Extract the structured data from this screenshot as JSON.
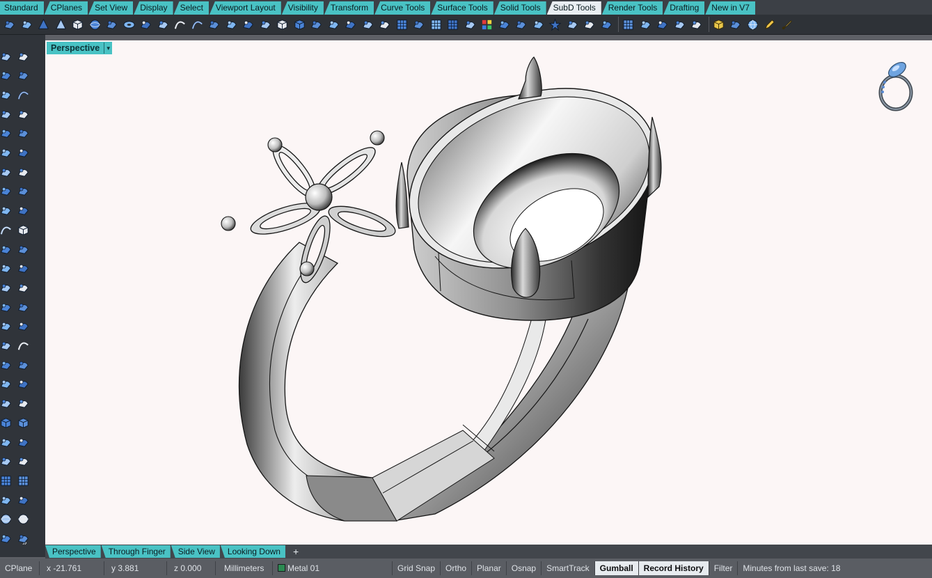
{
  "toolbar_tabs": [
    "Standard",
    "CPlanes",
    "Set View",
    "Display",
    "Select",
    "Viewport Layout",
    "Visibility",
    "Transform",
    "Curve Tools",
    "Surface Tools",
    "Solid Tools",
    "SubD Tools",
    "Render Tools",
    "Drafting",
    "New in V7"
  ],
  "active_tab": "SubD Tools",
  "toolbar_icons": [
    "point-icon",
    "rectangle-icon",
    "cone-icon",
    "cone-icon",
    "box-icon",
    "sphere-icon",
    "ellipsoid-icon",
    "torus-icon",
    "box-mesh-icon",
    "pipe-icon",
    "curve-icon",
    "curve-icon",
    "offset-icon",
    "branch-icon",
    "surface-icon",
    "surface-icon",
    "box-icon",
    "box-icon",
    "sweep-icon",
    "patch-icon",
    "surface-icon",
    "solid-icon",
    "solid-icon",
    "grid-icon",
    "bridge-icon",
    "grid-icon",
    "grid-icon",
    "transform-icon",
    "render-color-icon",
    "render-icon",
    "layer-icon",
    "pipe-icon",
    "star-icon",
    "light-icon",
    "material-icon",
    "environment-icon",
    "grid-icon",
    "tool-icon",
    "link-icon",
    "link-icon",
    "link-icon",
    "cube-icon",
    "pen-icon",
    "globe-icon",
    "pencil-icon",
    "brush-icon"
  ],
  "viewport": {
    "title": "Perspective",
    "accent_color": "#49c2c4",
    "background": "#fcf6f6"
  },
  "viewport_tabs": [
    "Perspective",
    "Through Finger",
    "Side View",
    "Looking Down"
  ],
  "status": {
    "cplane": "CPlane",
    "x": "x -21.761",
    "y": "y 3.881",
    "z": "z 0.000",
    "units": "Millimeters",
    "layer": "Metal 01",
    "layer_color": "#2b8a52",
    "grid_snap": "Grid Snap",
    "ortho": "Ortho",
    "planar": "Planar",
    "osnap": "Osnap",
    "smarttrack": "SmartTrack",
    "gumball": "Gumball",
    "record_history": "Record History",
    "filter": "Filter",
    "save_info": "Minutes from last save: 18"
  }
}
